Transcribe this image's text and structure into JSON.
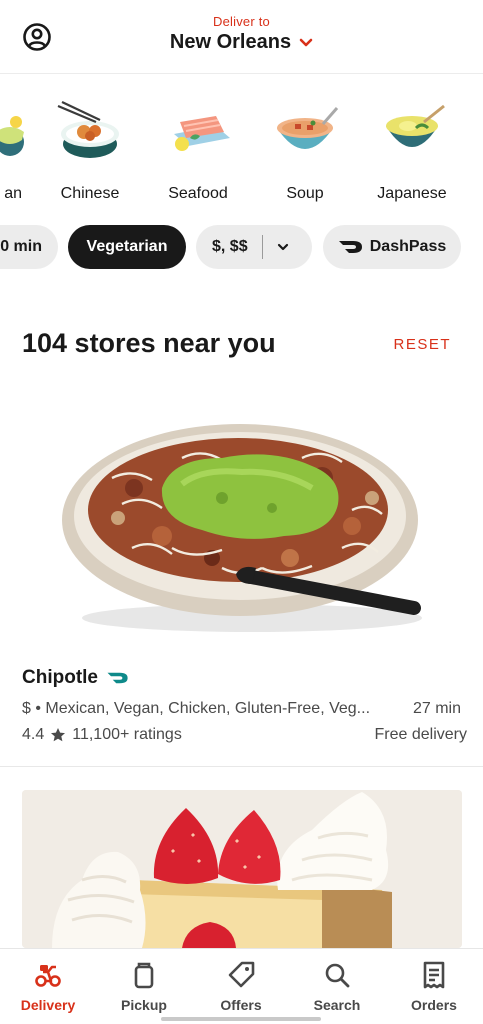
{
  "header": {
    "deliver_label": "Deliver to",
    "location": "New Orleans"
  },
  "cuisines": [
    {
      "label": "an",
      "icon": "partial-cuisine-icon"
    },
    {
      "label": "Chinese",
      "icon": "chinese-food-icon"
    },
    {
      "label": "Seafood",
      "icon": "seafood-icon"
    },
    {
      "label": "Soup",
      "icon": "soup-icon"
    },
    {
      "label": "Japanese",
      "icon": "japanese-food-icon"
    }
  ],
  "filters": {
    "time": "0 min",
    "vegetarian": "Vegetarian",
    "price": "$, $$",
    "dashpass": "DashPass"
  },
  "stores": {
    "title": "104 stores near you",
    "reset": "RESET"
  },
  "store": {
    "name": "Chipotle",
    "meta": "$ • Mexican, Vegan, Chicken, Gluten-Free, Veg...",
    "time": "27 min",
    "rating": "4.4",
    "ratings_count": "11,100+ ratings",
    "fee": "Free delivery"
  },
  "nav": {
    "delivery": "Delivery",
    "pickup": "Pickup",
    "offers": "Offers",
    "search": "Search",
    "orders": "Orders"
  },
  "colors": {
    "accent": "#d8311a",
    "dashpass": "#0e8a8a",
    "chip_bg": "#ececec",
    "chip_active": "#191919"
  }
}
